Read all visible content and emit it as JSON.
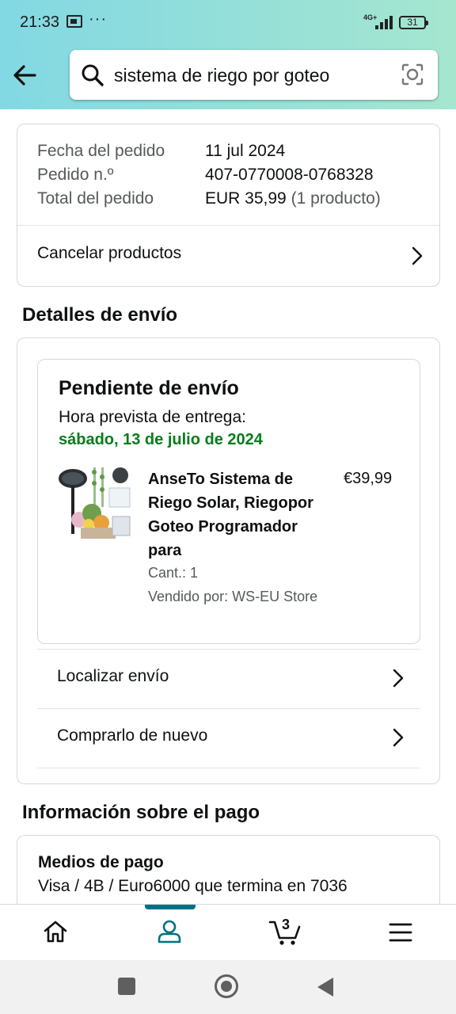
{
  "status_bar": {
    "time": "21:33",
    "network": "4G+",
    "battery": "31"
  },
  "header": {
    "search_value": "sistema de riego por goteo"
  },
  "order_summary": {
    "rows": [
      {
        "label": "Fecha del pedido",
        "value": "11 jul 2024"
      },
      {
        "label": "Pedido n.º",
        "value": "407-0770008-0768328"
      },
      {
        "label": "Total del pedido",
        "value": "EUR 35,99",
        "suffix": "(1 producto)"
      }
    ],
    "cancel_label": "Cancelar productos"
  },
  "shipping": {
    "section_title": "Detalles de envío",
    "status_title": "Pendiente de envío",
    "eta_label": "Hora prevista de entrega:",
    "eta_date": "sábado, 13 de julio de 2024",
    "product": {
      "title": "AnseTo Sistema de Riego Solar, Riegopor Goteo Programador para",
      "price": "€39,99",
      "quantity": "Cant.: 1",
      "seller": "Vendido por: WS-EU Store"
    },
    "track_label": "Localizar envío",
    "buy_again_label": "Comprarlo de nuevo"
  },
  "payment": {
    "section_title": "Información sobre el pago",
    "methods_title": "Medios de pago",
    "methods_value": "Visa / 4B / Euro6000  que termina en 7036"
  },
  "bottom_nav": {
    "cart_count": "3",
    "active": "account"
  },
  "colors": {
    "accent": "#007185",
    "eta_green": "#067d1a",
    "header_from": "#82d8e3",
    "header_to": "#a5e6cf"
  },
  "icons": [
    "back-arrow-icon",
    "search-icon",
    "camera-lens-icon",
    "chevron-right-icon",
    "home-icon",
    "user-icon",
    "cart-icon",
    "menu-icon"
  ]
}
